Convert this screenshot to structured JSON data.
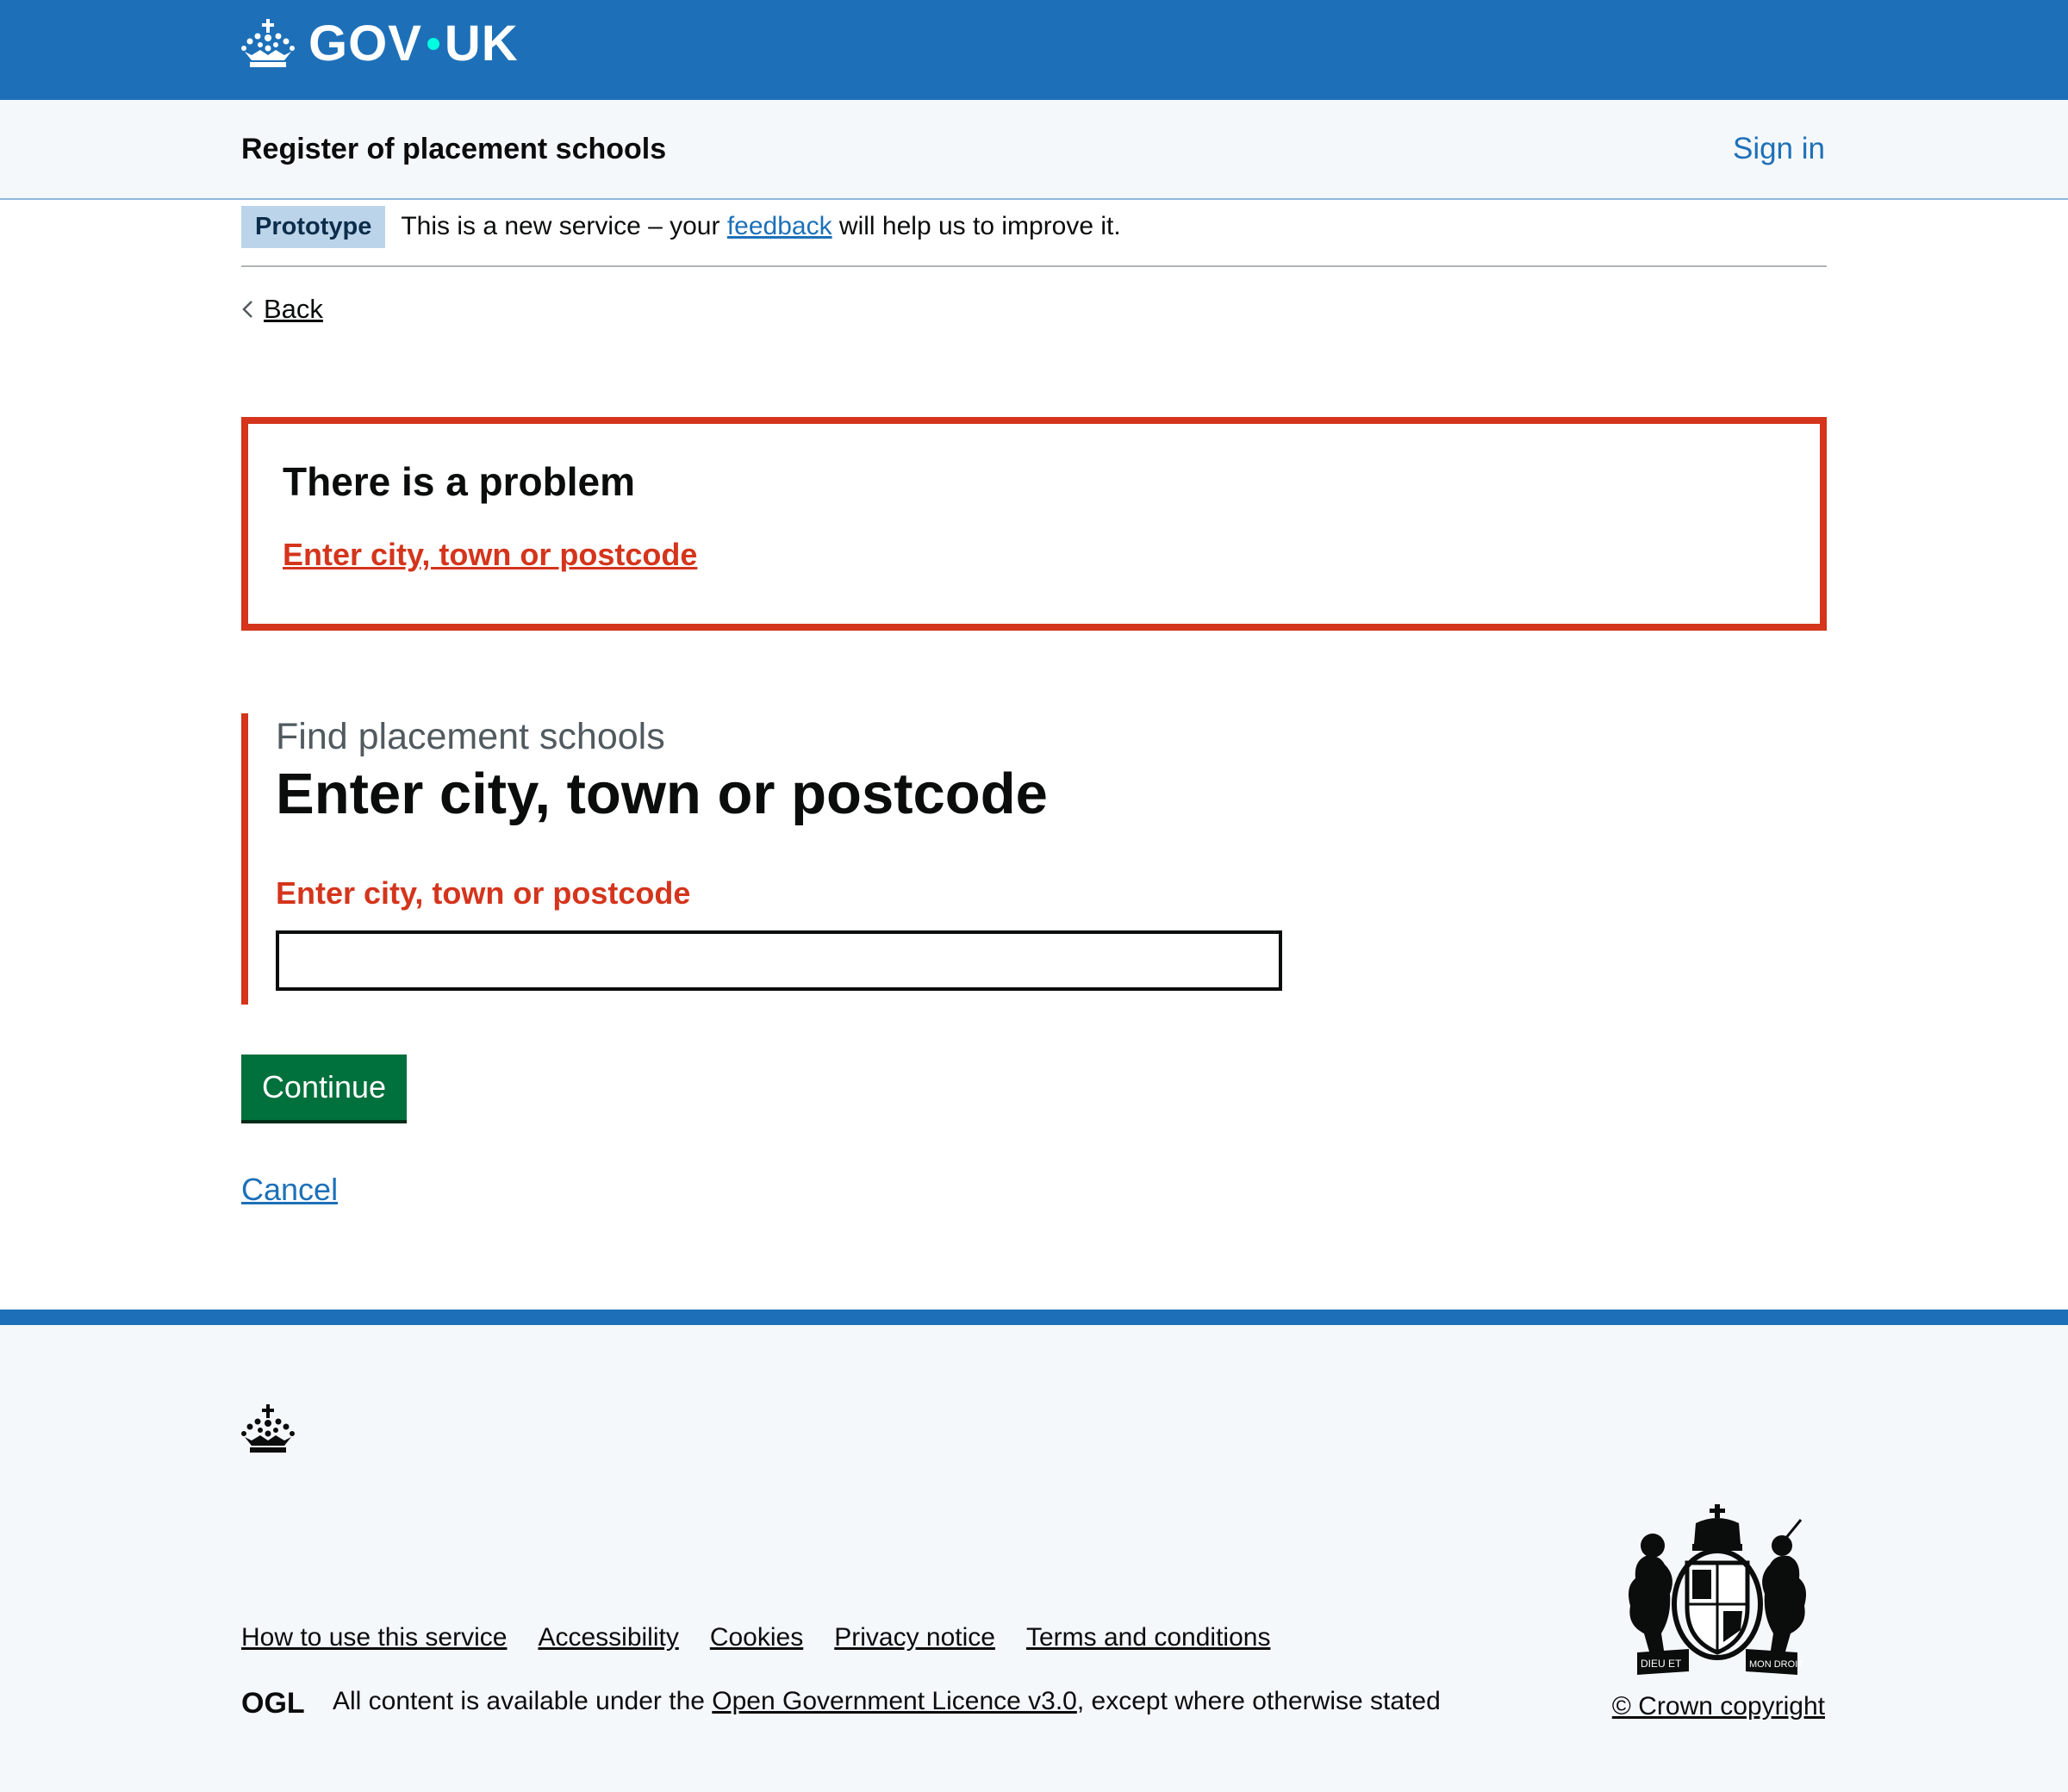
{
  "header": {
    "logo_text_left": "GOV",
    "logo_text_right": "UK",
    "logo_icon": "crown-icon",
    "brand_color": "#1d70b8",
    "dot_color": "#00ffe0"
  },
  "service_nav": {
    "service_name": "Register of placement schools",
    "sign_in_label": "Sign in"
  },
  "phase_banner": {
    "tag": "Prototype",
    "text_before": "This is a new service – your ",
    "link_text": "feedback",
    "text_after": " will help us to improve it."
  },
  "back_link": {
    "label": "Back",
    "icon": "chevron-left-icon"
  },
  "error_summary": {
    "title": "There is a problem",
    "errors": [
      "Enter city, town or postcode"
    ],
    "color": "#d4351c"
  },
  "form": {
    "caption": "Find placement schools",
    "heading": "Enter city, town or postcode",
    "error_message": "Enter city, town or postcode",
    "input_value": "",
    "continue_label": "Continue",
    "cancel_label": "Cancel",
    "button_color": "#00703c"
  },
  "footer": {
    "links": [
      "How to use this service",
      "Accessibility",
      "Cookies",
      "Privacy notice",
      "Terms and conditions"
    ],
    "licence_text_before": "All content is available under the ",
    "licence_link": "Open Government Licence v3.0",
    "licence_text_after": ", except where otherwise stated",
    "ogl_label": "OGL",
    "copyright": "© Crown copyright",
    "crest_motto_left": "DIEU ET",
    "crest_motto_right": "MON DROIT",
    "crown_icon": "crown-icon",
    "crest_icon": "royal-coat-of-arms-icon"
  }
}
